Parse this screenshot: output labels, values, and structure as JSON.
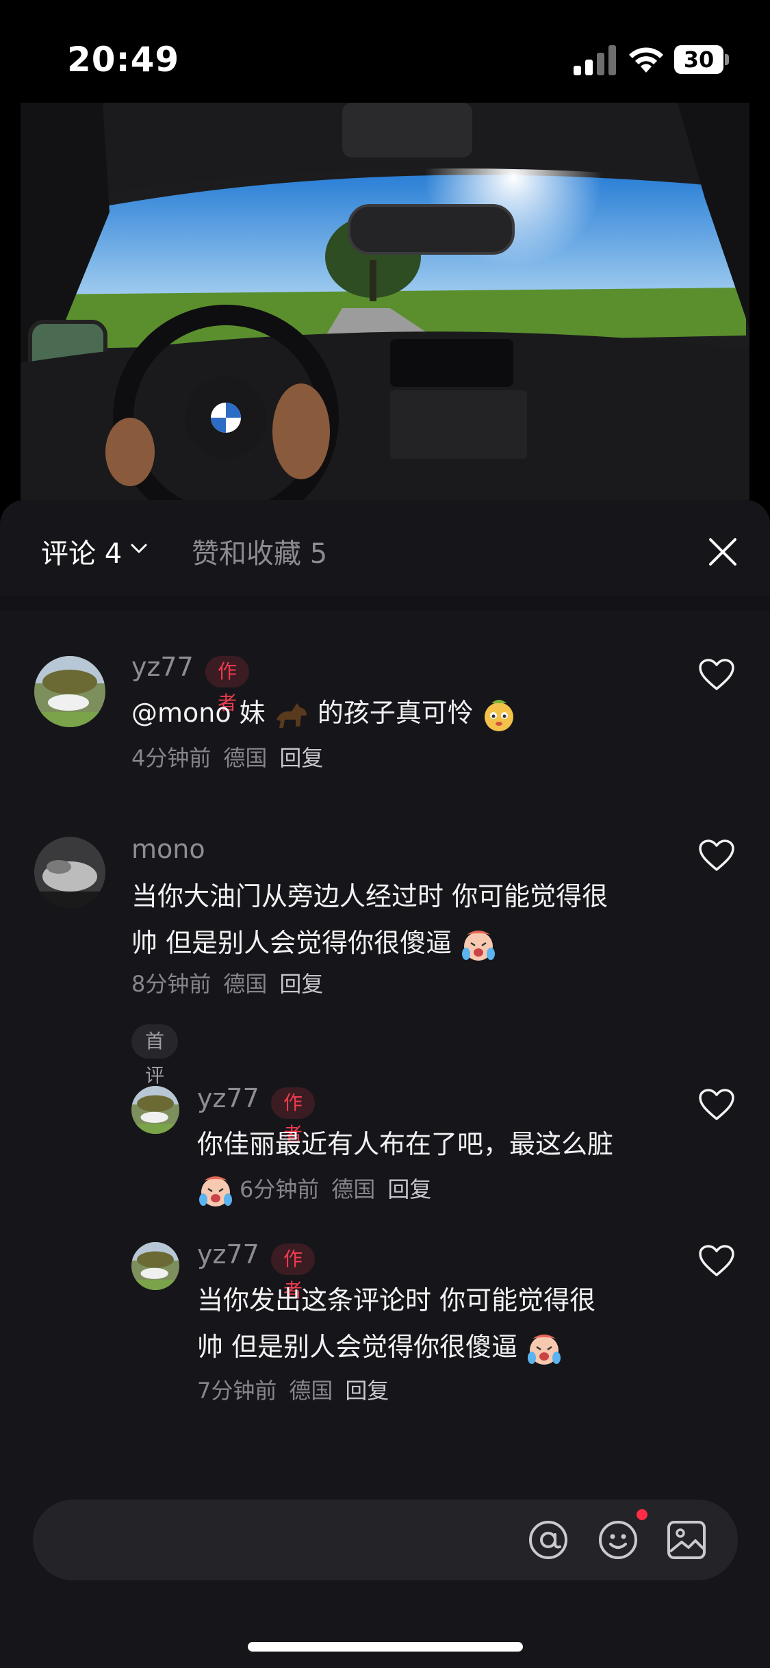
{
  "status": {
    "time": "20:49",
    "battery": "30"
  },
  "tabs": {
    "comments": "评论 4",
    "likes": "赞和收藏 5"
  },
  "comments": [
    {
      "user": "yz77",
      "tag": "作者",
      "text": "@mono 妹",
      "text2": "的孩子真可怜",
      "time": "4分钟前",
      "location": "德国",
      "reply": "回复"
    },
    {
      "user": "mono",
      "text_line1": "当你大油门从旁边人经过时 你可能觉得很",
      "text_line2": "帅 但是别人会觉得你很傻逼",
      "time": "8分钟前",
      "location": "德国",
      "reply": "回复",
      "badge": "首评"
    },
    {
      "user": "yz77",
      "tag": "作者",
      "text_line1": "你佳丽最近有人布在了吧，最这么脏",
      "time": "6分钟前",
      "location": "德国",
      "reply": "回复"
    },
    {
      "user": "yz77",
      "tag": "作者",
      "text_line1": "当你发出这条评论时 你可能觉得很",
      "text_line2": "帅 但是别人会觉得你很傻逼",
      "time": "7分钟前",
      "location": "德国",
      "reply": "回复"
    }
  ],
  "input": {
    "placeholder": ""
  },
  "colors": {
    "author_tag": "#f03b4f",
    "panel_bg": "#16161a",
    "notification_dot": "#ff2b48"
  },
  "icons": [
    "signal-icon",
    "wifi-icon",
    "chevron-down-icon",
    "close-icon",
    "heart-icon",
    "at-icon",
    "emoji-icon",
    "image-icon"
  ]
}
